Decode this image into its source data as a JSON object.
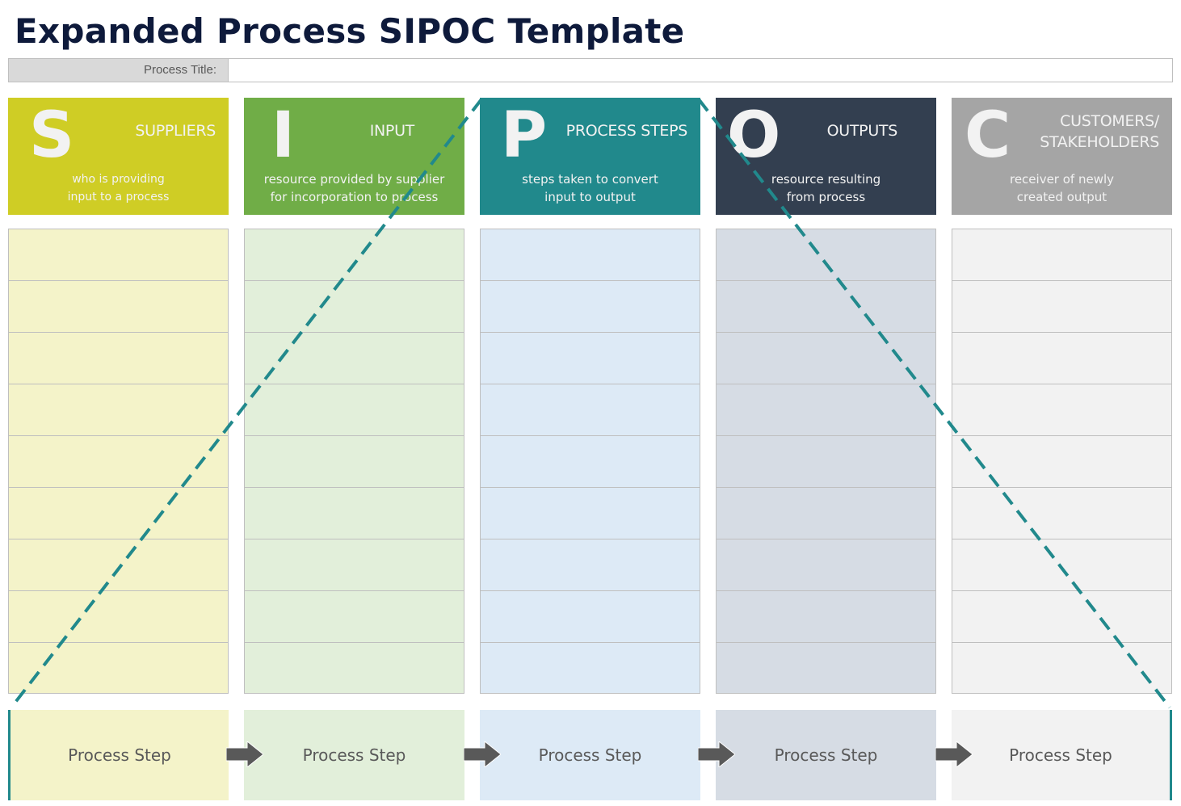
{
  "title": "Expanded Process SIPOC Template",
  "process_title": {
    "label": "Process Title:",
    "value": "",
    "placeholder": ""
  },
  "columns": [
    {
      "letter": "S",
      "name": "SUPPLIERS",
      "desc1": "who is providing",
      "desc2": "input to a process",
      "header_color": "#cfcd25",
      "body_color": "#f4f3c9",
      "step_label": "Process Step"
    },
    {
      "letter": "I",
      "name": "INPUT",
      "desc1": "resource provided by supplier",
      "desc2": "for incorporation to process",
      "header_color": "#70ad47",
      "body_color": "#e2efda",
      "step_label": "Process Step"
    },
    {
      "letter": "P",
      "name": "PROCESS STEPS",
      "desc1": "steps taken to convert",
      "desc2": "input to output",
      "header_color": "#21898c",
      "body_color": "#ddeaf6",
      "step_label": "Process Step"
    },
    {
      "letter": "O",
      "name": "OUTPUTS",
      "desc1": "resource resulting",
      "desc2": "from process",
      "header_color": "#333f50",
      "body_color": "#d6dce4",
      "step_label": "Process Step"
    },
    {
      "letter": "C",
      "name_line1": "CUSTOMERS/",
      "name_line2": "STAKEHOLDERS",
      "desc1": "receiver of newly",
      "desc2": "created output",
      "header_color": "#a5a5a5",
      "body_color": "#f2f2f2",
      "step_label": "Process Step"
    }
  ],
  "body_rows_per_column": 9,
  "accent_color": "#21898c",
  "arrow_color": "#595959"
}
